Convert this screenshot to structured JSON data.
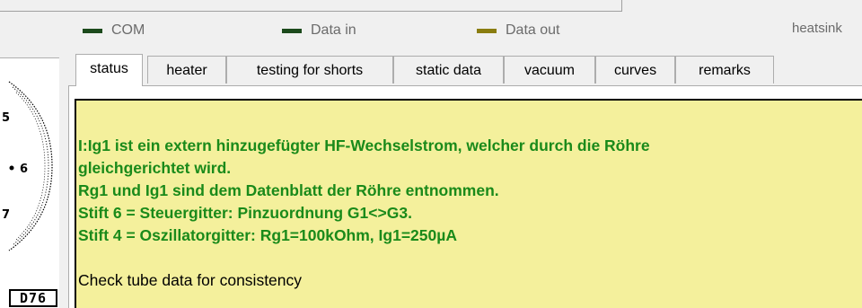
{
  "indicators": [
    {
      "label": "COM",
      "color": "#1c4a1c"
    },
    {
      "label": "Data in",
      "color": "#1c4a1c"
    },
    {
      "label": "Data out",
      "color": "#8a7d10"
    }
  ],
  "heatsink_label": "heatsink",
  "socket": {
    "pin_labels": [
      "5",
      "6",
      "7"
    ],
    "tube_code": "D76"
  },
  "tabs": [
    {
      "label": "status",
      "active": true
    },
    {
      "label": "heater"
    },
    {
      "label": "testing for shorts"
    },
    {
      "label": "static data"
    },
    {
      "label": "vacuum"
    },
    {
      "label": "curves"
    },
    {
      "label": "remarks"
    }
  ],
  "status_panel": {
    "background": "#f4f09c",
    "message_color": "#1a8a1a",
    "lines": [
      "I:Ig1 ist ein extern hinzugefügter HF-Wechselstrom, welcher durch die Röhre",
      "gleichgerichtet wird.",
      "Rg1 und Ig1 sind dem Datenblatt der Röhre entnommen.",
      "Stift 6 = Steuergitter: Pinzuordnung G1<>G3.",
      "Stift 4 = Oszillatorgitter: Rg1=100kOhm, Ig1=250µA"
    ],
    "check_text": "Check tube data for consistency"
  }
}
